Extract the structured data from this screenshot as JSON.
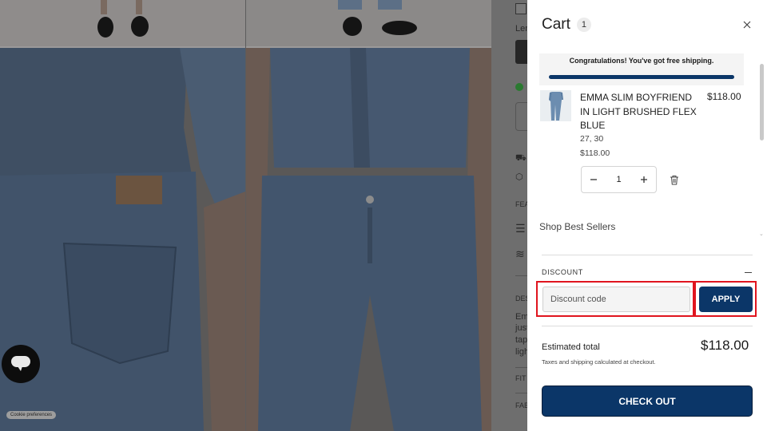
{
  "cart": {
    "title": "Cart",
    "count": "1",
    "free_shipping_message": "Congratulations! You've got free shipping.",
    "items": [
      {
        "name": "EMMA SLIM BOYFRIEND IN LIGHT BRUSHED FLEX BLUE",
        "price": "$118.00",
        "variant": "27, 30",
        "unit_price": "$118.00",
        "quantity": "1"
      }
    ],
    "best_sellers_label": "Shop Best Sellers",
    "discount": {
      "title": "DISCOUNT",
      "placeholder": "Discount code",
      "apply_label": "APPLY"
    },
    "estimated_total_label": "Estimated total",
    "estimated_total_value": "$118.00",
    "tax_note": "Taxes and shipping calculated at checkout.",
    "checkout_label": "CHECK OUT"
  },
  "page_background": {
    "side_fragments": [
      "Len",
      "FEA",
      "DES",
      "Em",
      "just",
      "tap",
      "ligh",
      "FIT",
      "FAB"
    ],
    "cookie_label": "Cookie preferences"
  },
  "colors": {
    "brand_navy": "#0b3668",
    "highlight_red": "#e0141e",
    "status_green": "#2fa83a"
  },
  "icons": {
    "close": "close-icon",
    "minus": "minus-icon",
    "plus": "plus-icon",
    "trash": "trash-icon",
    "chat": "chat-icon",
    "collapse": "minus-icon"
  }
}
